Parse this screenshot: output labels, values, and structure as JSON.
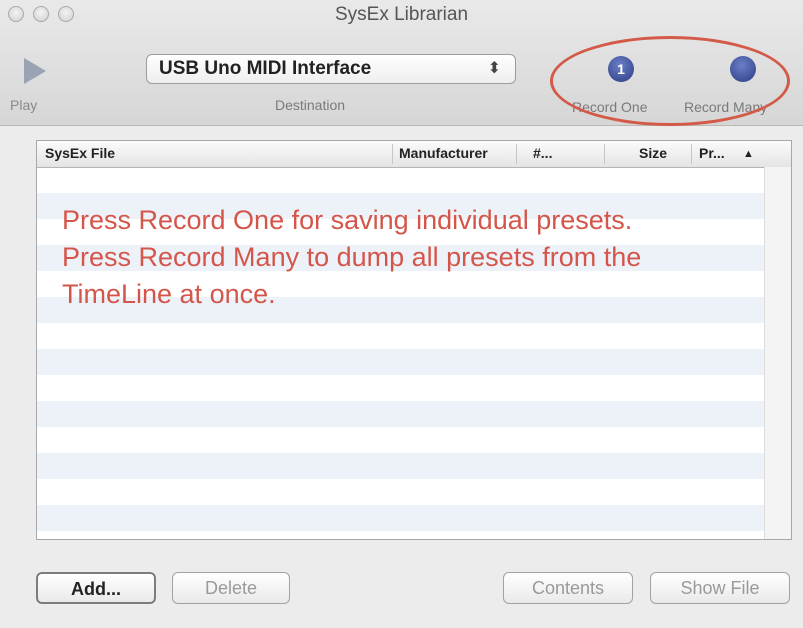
{
  "window": {
    "title": "SysEx Librarian"
  },
  "toolbar": {
    "play_label": "Play",
    "destination_value": "USB Uno MIDI Interface",
    "destination_label": "Destination",
    "record_one_label": "Record One",
    "record_one_badge": "1",
    "record_many_label": "Record Many"
  },
  "table": {
    "columns": [
      "SysEx File",
      "Manufacturer",
      "#...",
      "Size",
      "Pr..."
    ],
    "sort_indicator": "▲",
    "rows": []
  },
  "annotation": {
    "line1": "Press Record One for saving individual presets.",
    "line2": "Press Record Many to dump all presets from the",
    "line3": "TimeLine at once."
  },
  "buttons": {
    "add": "Add...",
    "delete": "Delete",
    "contents": "Contents",
    "show_file": "Show File"
  },
  "colors": {
    "annotation": "#d4564a",
    "record_button": "#2b3c82",
    "stripe": "#edf2f9"
  }
}
